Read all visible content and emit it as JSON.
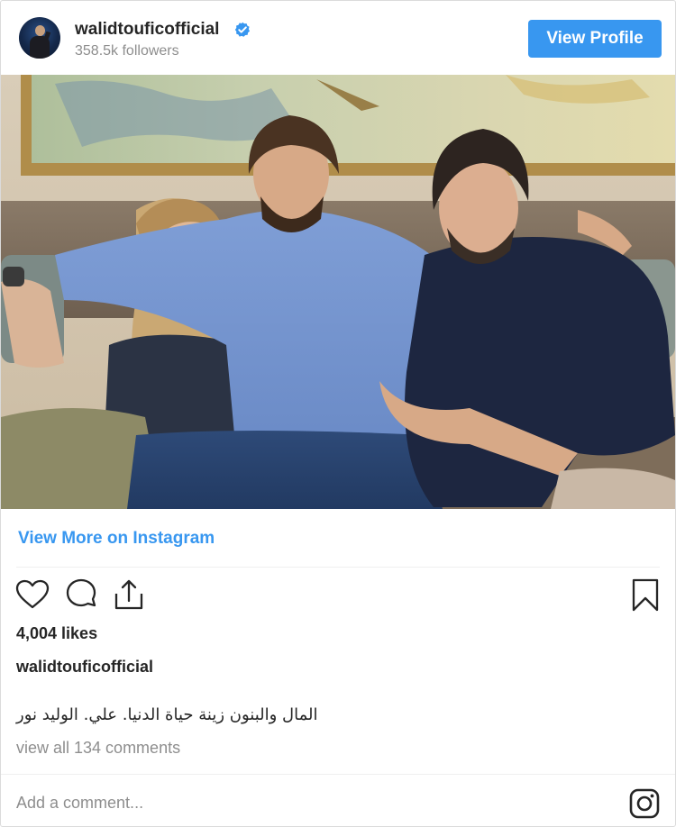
{
  "header": {
    "username": "walidtouficofficial",
    "followers": "358.5k followers",
    "view_profile_label": "View Profile",
    "verified_icon": "verified-badge-icon"
  },
  "colors": {
    "accent": "#3897f0",
    "text": "#262626",
    "muted": "#8e8e8e",
    "border": "#dbdbdb"
  },
  "post": {
    "image_alt": "Photo of three people sitting on a couch",
    "view_more_label": "View More on Instagram",
    "actions": [
      "heart-icon",
      "comment-icon",
      "share-icon",
      "bookmark-icon"
    ],
    "likes": "4,004 likes",
    "caption_user": "walidtouficofficial",
    "caption_text": "المال والبنون زينة حياة الدنيا. علي. الوليد نور",
    "comments_link": "view all 134 comments"
  },
  "comment_box": {
    "placeholder": "Add a comment...",
    "logo_icon": "instagram-icon"
  }
}
